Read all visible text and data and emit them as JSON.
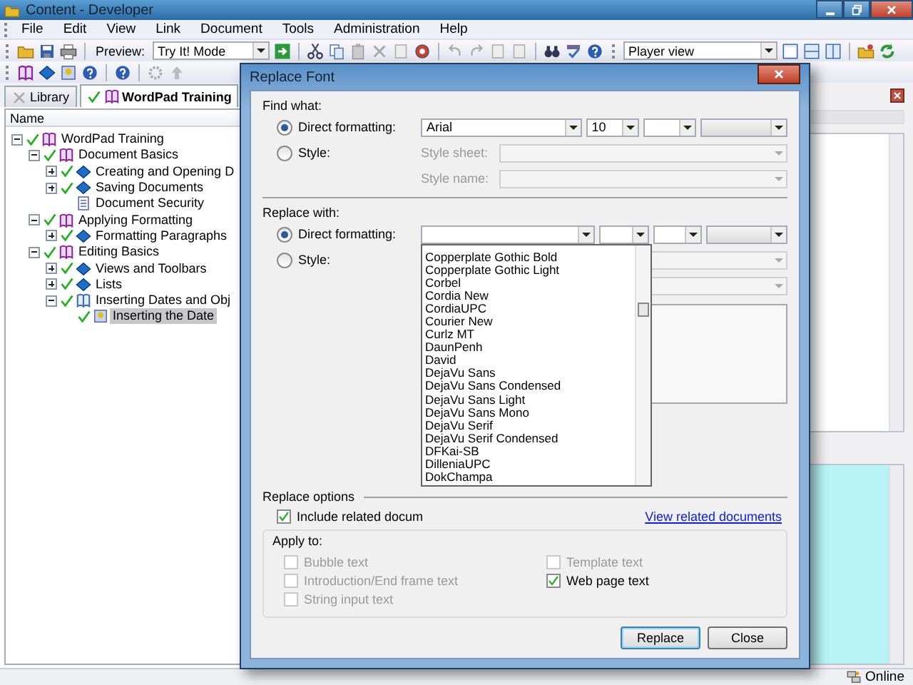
{
  "window": {
    "title": "Content - Developer"
  },
  "menu": [
    "File",
    "Edit",
    "View",
    "Link",
    "Document",
    "Tools",
    "Administration",
    "Help"
  ],
  "toolbar": {
    "preview_label": "Preview:",
    "preview_mode": "Try It! Mode",
    "view_mode": "Player view"
  },
  "tabs": [
    {
      "label": "Library",
      "selected": false
    },
    {
      "label": "WordPad Training",
      "selected": true
    }
  ],
  "tree": {
    "column": "Name",
    "items": [
      {
        "label": "WordPad Training",
        "kind": "outline",
        "checked": true,
        "expanded": true,
        "selected": false,
        "children": [
          {
            "label": "Document Basics",
            "kind": "outline",
            "checked": true,
            "expanded": true,
            "selected": false,
            "children": [
              {
                "label": "Creating and Opening D",
                "kind": "module",
                "checked": true,
                "expanded": false,
                "selected": false
              },
              {
                "label": "Saving Documents",
                "kind": "module",
                "checked": true,
                "expanded": false,
                "selected": false
              },
              {
                "label": "Document Security",
                "kind": "page",
                "checked": false,
                "selected": false
              }
            ]
          },
          {
            "label": "Applying Formatting",
            "kind": "outline",
            "checked": true,
            "expanded": true,
            "selected": false,
            "children": [
              {
                "label": "Formatting Paragraphs",
                "kind": "module",
                "checked": true,
                "expanded": false,
                "selected": false
              }
            ]
          },
          {
            "label": "Editing Basics",
            "kind": "outline",
            "checked": true,
            "expanded": true,
            "selected": false,
            "children": [
              {
                "label": "Views and Toolbars",
                "kind": "module",
                "checked": true,
                "expanded": false,
                "selected": false
              },
              {
                "label": "Lists",
                "kind": "module",
                "checked": true,
                "expanded": false,
                "selected": false
              },
              {
                "label": "Inserting Dates and Obj",
                "kind": "section",
                "checked": true,
                "expanded": true,
                "selected": false,
                "children": [
                  {
                    "label": "Inserting the Date",
                    "kind": "topic",
                    "checked": true,
                    "selected": true
                  }
                ]
              }
            ]
          }
        ]
      }
    ]
  },
  "dialog": {
    "title": "Replace Font",
    "find": {
      "heading": "Find what:",
      "options": [
        {
          "label": "Direct formatting:",
          "selected": true
        },
        {
          "label": "Style:",
          "selected": false
        }
      ],
      "font": "Arial",
      "size": "10",
      "style_sheet": {
        "label": "Style sheet:",
        "disabled": true
      },
      "style_name": {
        "label": "Style name:",
        "disabled": true
      }
    },
    "replace": {
      "heading": "Replace with:",
      "options": [
        {
          "label": "Direct formatting:",
          "selected": true
        },
        {
          "label": "Style:",
          "selected": false
        }
      ],
      "font_list": [
        "Copperplate Gothic Bold",
        "Copperplate Gothic Light",
        "Corbel",
        "Cordia New",
        "CordiaUPC",
        "Courier New",
        "Curlz MT",
        "DaunPenh",
        "David",
        "DejaVu Sans",
        "DejaVu Sans Condensed",
        "DejaVu Sans Light",
        "DejaVu Sans Mono",
        "DejaVu Serif",
        "DejaVu Serif Condensed",
        "DFKai-SB",
        "DilleniaUPC",
        "DokChampa"
      ]
    },
    "replace_options": {
      "heading": "Replace options",
      "include": {
        "label": "Include related docum",
        "checked": true
      },
      "link": "View related documents",
      "apply_heading": "Apply to:",
      "checkboxes": [
        {
          "label": "Bubble text",
          "checked": false,
          "disabled": true
        },
        {
          "label": "Template text",
          "checked": false,
          "disabled": true
        },
        {
          "label": "Introduction/End frame text",
          "checked": false,
          "disabled": true
        },
        {
          "label": "Web page text",
          "checked": true,
          "disabled": false
        },
        {
          "label": "String input text",
          "checked": false,
          "disabled": true
        }
      ]
    },
    "buttons": [
      {
        "label": "Replace",
        "default": true
      },
      {
        "label": "Close",
        "default": false
      }
    ]
  },
  "status_bar": {
    "text": "Online"
  }
}
